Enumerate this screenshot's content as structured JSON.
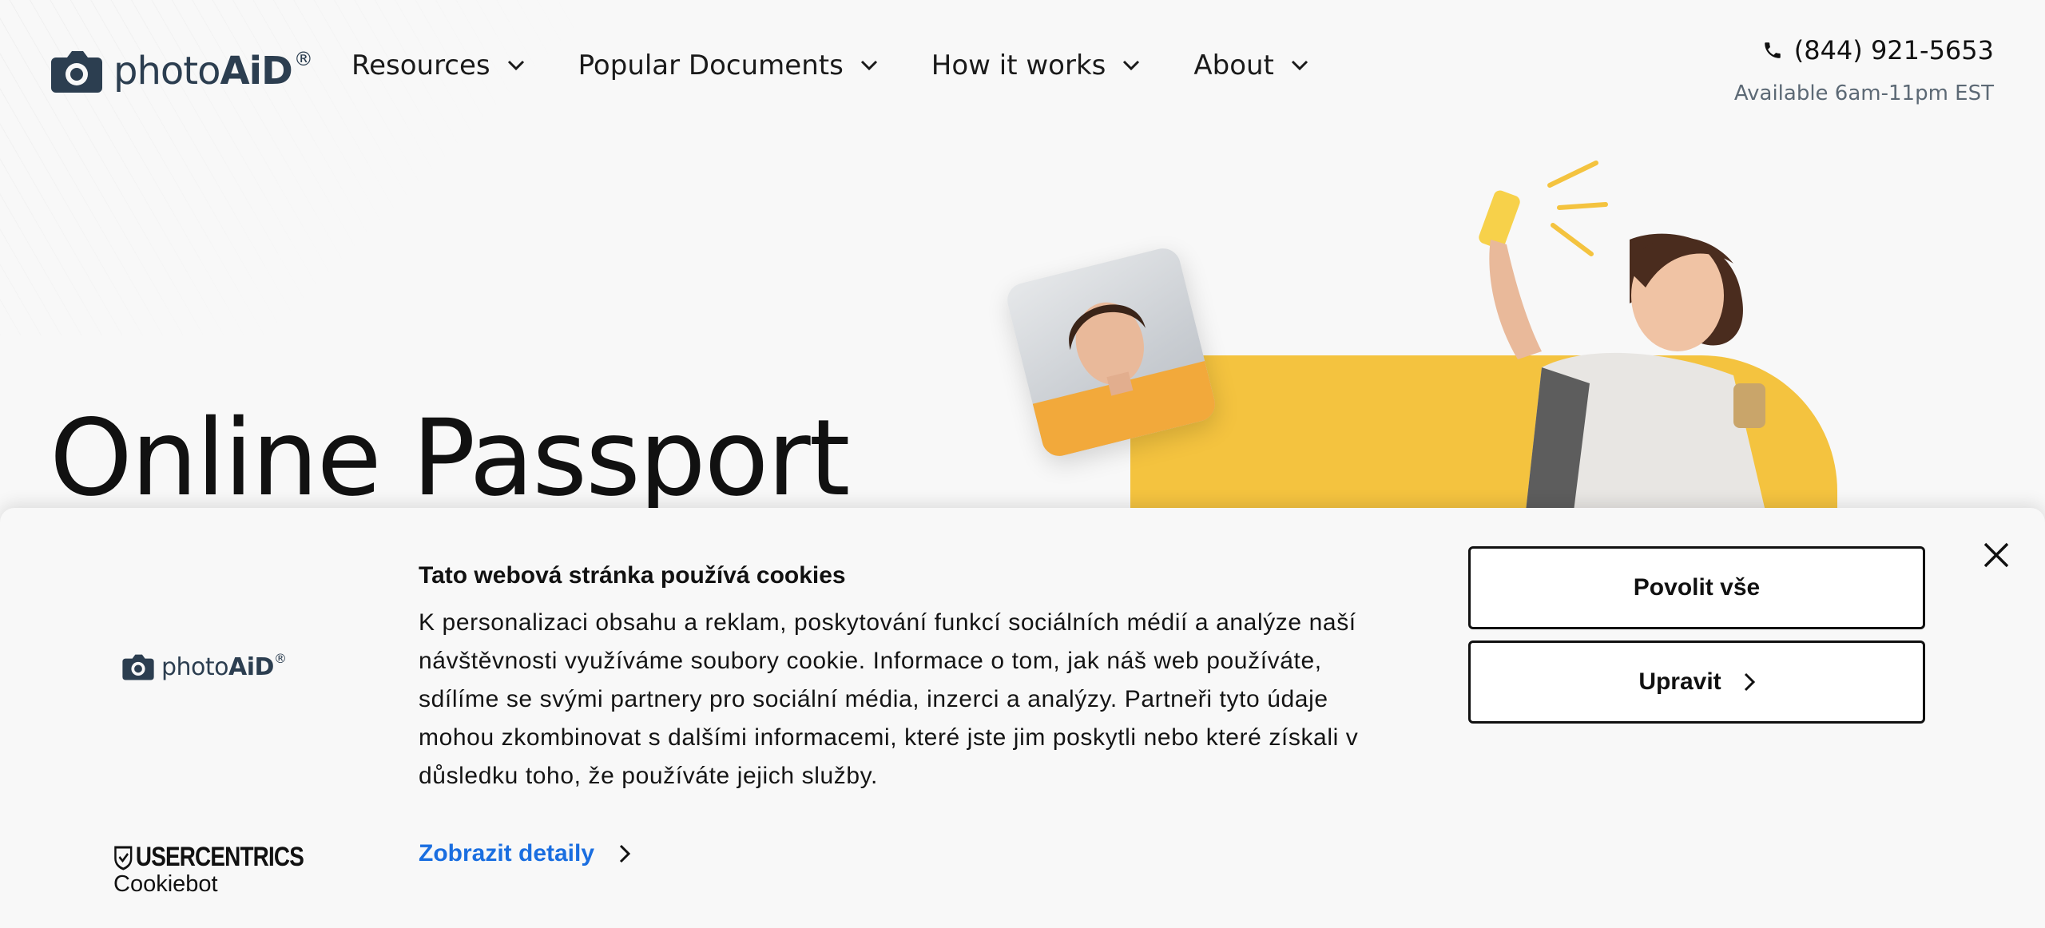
{
  "brand": {
    "name_light": "photo",
    "name_bold": "AiD",
    "mark": "®"
  },
  "nav": {
    "items": [
      {
        "label": "Resources"
      },
      {
        "label": "Popular Documents"
      },
      {
        "label": "How it works"
      },
      {
        "label": "About"
      }
    ]
  },
  "contact": {
    "phone": "(844) 921-5653",
    "availability": "Available 6am-11pm EST"
  },
  "hero": {
    "title": "Online Passport"
  },
  "cookie_banner": {
    "title": "Tato webová stránka používá cookies",
    "body": "K personalizaci obsahu a reklam, poskytování funkcí sociálních médií a analýze naší návštěvnosti využíváme soubory cookie. Informace o tom, jak náš web používáte, sdílíme se svými partnery pro sociální média, inzerci a analýzy. Partneři tyto údaje mohou zkombinovat s dalšími informacemi, které jste jim poskytli nebo které získali v důsledku toho, že používáte jejich služby.",
    "details_link": "Zobrazit detaily",
    "accept_all_label": "Povolit vše",
    "customize_label": "Upravit",
    "provider_top": "USERCENTRICS",
    "provider_bottom": "Cookiebot"
  },
  "icons": {
    "logo": "camera-icon",
    "chevron": "chevron-down-icon",
    "phone": "phone-icon",
    "close": "close-icon",
    "arrow": "chevron-right-icon"
  },
  "colors": {
    "accent_yellow": "#f4c33f",
    "link_blue": "#1a6ee0",
    "brand_navy": "#2c3e50"
  }
}
